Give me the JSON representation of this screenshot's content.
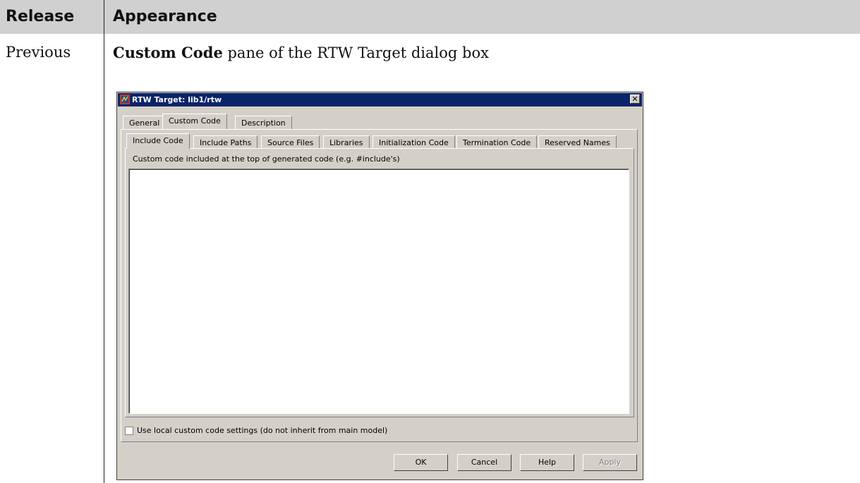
{
  "table": {
    "header": {
      "release": "Release",
      "appearance": "Appearance"
    },
    "row": {
      "release": "Previous",
      "description_bold": "Custom Code",
      "description_rest": " pane of the RTW Target dialog box"
    }
  },
  "dialog": {
    "title": "RTW Target: lib1/rtw",
    "close_glyph": "✕",
    "top_tabs": [
      "General",
      "Custom Code",
      "Description"
    ],
    "selected_top_tab": "Custom Code",
    "sub_tabs": [
      "Include Code",
      "Include Paths",
      "Source Files",
      "Libraries",
      "Initialization Code",
      "Termination Code",
      "Reserved Names"
    ],
    "selected_sub_tab": "Include Code",
    "code_label": "Custom code included at the top of generated code (e.g. #include's)",
    "code_value": "",
    "checkbox_label": "Use local custom code settings (do not inherit from main model)",
    "checkbox_checked": false,
    "buttons": {
      "ok": "OK",
      "cancel": "Cancel",
      "help": "Help",
      "apply": "Apply"
    },
    "colors": {
      "titlebar": "#0a246a",
      "face": "#d4d0c8"
    }
  }
}
